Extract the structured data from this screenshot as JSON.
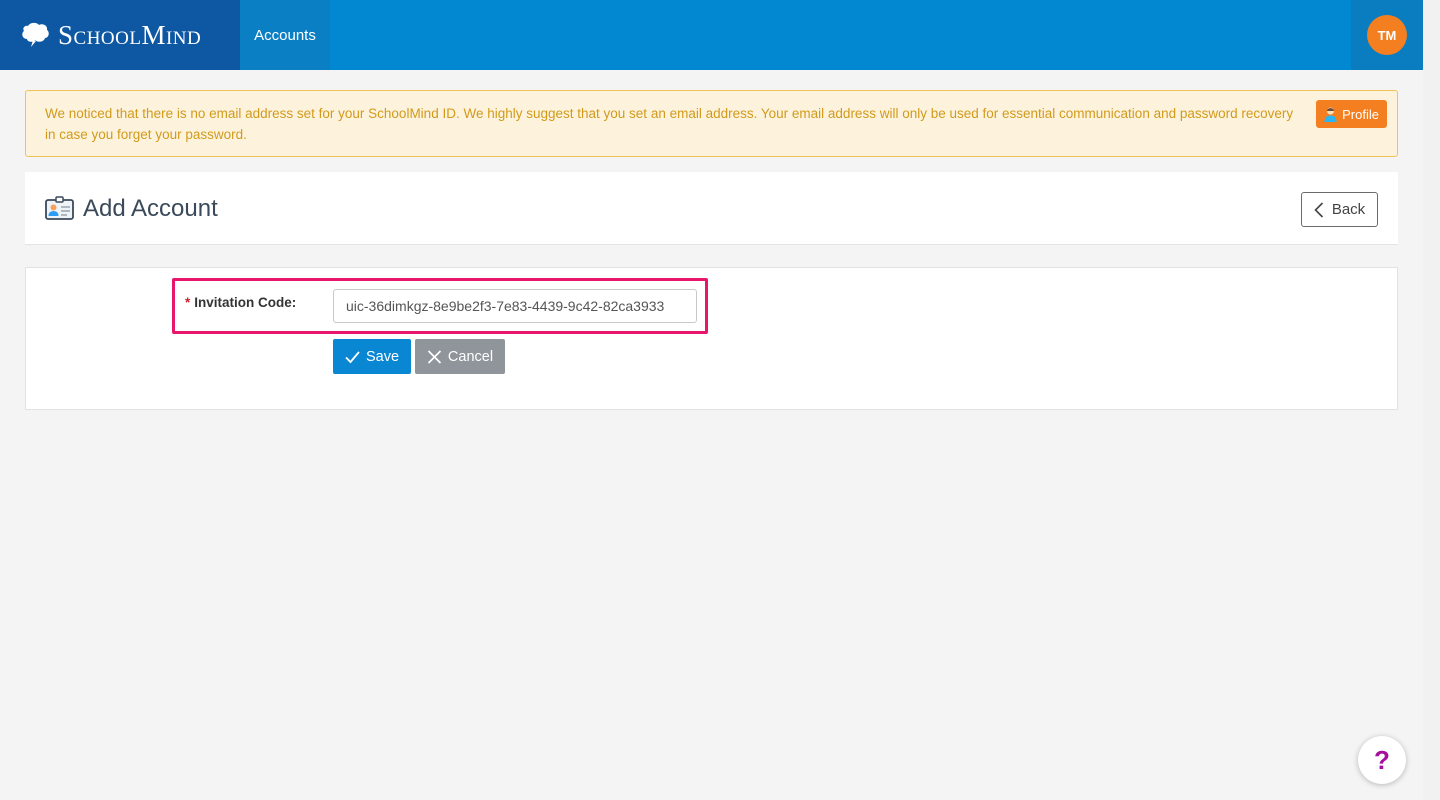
{
  "header": {
    "brand": "SchoolMind",
    "nav_accounts": "Accounts",
    "avatar_initials": "TM"
  },
  "alert": {
    "message": "We noticed that there is no email address set for your SchoolMind ID. We highly suggest that you set an email address. Your email address will only be used for essential communication and password recovery in case you forget your password.",
    "profile_label": "Profile"
  },
  "page": {
    "title": "Add Account",
    "back_label": "Back"
  },
  "form": {
    "required_mark": "*",
    "invitation_label": "Invitation Code:",
    "invitation_value": "uic-36dimkgz-8e9be2f3-7e83-4439-9c42-82ca3933",
    "save_label": "Save",
    "cancel_label": "Cancel"
  },
  "help": {
    "label": "?"
  },
  "colors": {
    "topbar": "#0288d1",
    "brand_bg": "#0d57a3",
    "avatar": "#f37f20",
    "highlight": "#e8176c",
    "save": "#0a87d3",
    "cancel": "#8f959a"
  }
}
